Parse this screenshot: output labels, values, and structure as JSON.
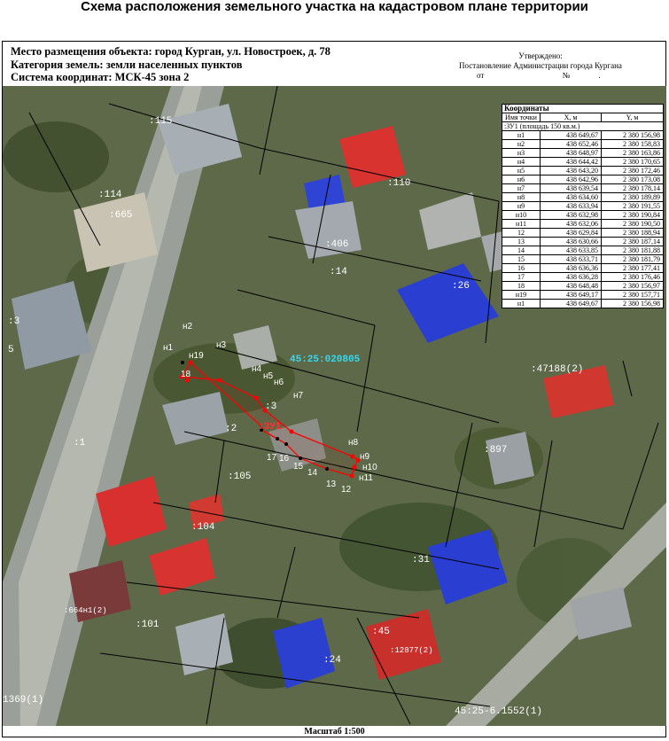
{
  "title": "Схема расположения земельного участка на кадастровом плане территории",
  "header": {
    "location": "Место размещения объекта: город Курган, ул. Новостроек, д. 78",
    "category": "Категория земель: земли населенных пунктов",
    "system": "Система координат: МСК-45 зона 2"
  },
  "approval": {
    "line1": "Утверждено:",
    "line2": "Постановление Администрации города Кургана",
    "from_label": "от",
    "no_label": "№"
  },
  "scale": "Масштаб 1:500",
  "table": {
    "caption": "Координаты",
    "col_point": "Имя точки",
    "col_x": "X, м",
    "col_y": "Y, м",
    "plot_row": ":ЗУ1 (площадь 150 кв.м.)",
    "rows": [
      {
        "name": "н1",
        "x": "438 649,67",
        "y": "2 380 156,98"
      },
      {
        "name": "н2",
        "x": "438 652,46",
        "y": "2 380 158,83"
      },
      {
        "name": "н3",
        "x": "438 648,97",
        "y": "2 380 163,86"
      },
      {
        "name": "н4",
        "x": "438 644,42",
        "y": "2 380 170,65"
      },
      {
        "name": "н5",
        "x": "438 643,20",
        "y": "2 380 172,46"
      },
      {
        "name": "н6",
        "x": "438 642,96",
        "y": "2 380 173,08"
      },
      {
        "name": "н7",
        "x": "438 639,54",
        "y": "2 380 178,14"
      },
      {
        "name": "н8",
        "x": "438 634,60",
        "y": "2 380 189,89"
      },
      {
        "name": "н9",
        "x": "438 633,94",
        "y": "2 380 191,55"
      },
      {
        "name": "н10",
        "x": "438 632,98",
        "y": "2 380 190,84"
      },
      {
        "name": "н11",
        "x": "438 632,06",
        "y": "2 380 190,50"
      },
      {
        "name": "12",
        "x": "438 629,84",
        "y": "2 380 188,94"
      },
      {
        "name": "13",
        "x": "438 630,66",
        "y": "2 380 187,14"
      },
      {
        "name": "14",
        "x": "438 633,85",
        "y": "2 380 181,88"
      },
      {
        "name": "15",
        "x": "438 633,71",
        "y": "2 380 181,79"
      },
      {
        "name": "16",
        "x": "438 636,36",
        "y": "2 380 177,41"
      },
      {
        "name": "17",
        "x": "438 636,28",
        "y": "2 380 176,46"
      },
      {
        "name": "18",
        "x": "438 648,48",
        "y": "2 380 156,97"
      },
      {
        "name": "н19",
        "x": "438 649,17",
        "y": "2 380 157,71"
      },
      {
        "name": "н1",
        "x": "438 649,67",
        "y": "2 380 156,98"
      }
    ]
  },
  "map": {
    "quarter_label": "45:25:020805",
    "plot_label": ":ЗУ1",
    "parcel_labels": [
      ":115",
      ":114",
      ":665",
      ":110",
      ":406",
      ":14",
      ":26",
      ":3",
      ":47188(2)",
      ":897",
      ":105",
      ":104",
      ":31",
      ":664н1(2)",
      ":101",
      ":45",
      ":12877(2)",
      ":24",
      "1369(1)",
      "45:25-6.1552(1)",
      ":2",
      ":1",
      ":3",
      "5"
    ],
    "point_labels": [
      "н1",
      "н2",
      "н3",
      "н4",
      "н5",
      "н6",
      "н7",
      "н8",
      "н9",
      "н10",
      "н11",
      "н19",
      "18",
      "17",
      "16",
      "15",
      "14",
      "13",
      "12"
    ],
    "plot_boundary_color": "#ff0000",
    "quarter_label_color": "#38d8f0",
    "roof_colors": {
      "blue": "#2a3fd1",
      "red": "#d9332f",
      "grey": "#9aa4ad"
    }
  }
}
